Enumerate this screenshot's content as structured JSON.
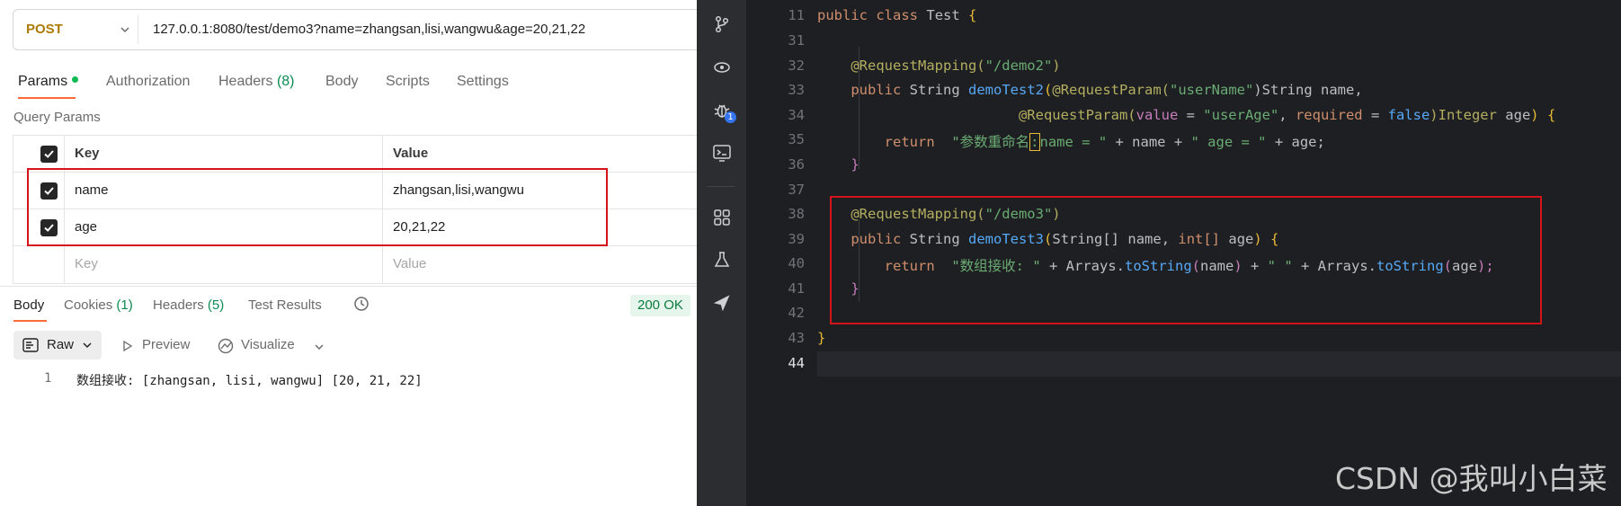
{
  "request": {
    "method": "POST",
    "url": "127.0.0.1:8080/test/demo3?name=zhangsan,lisi,wangwu&age=20,21,22"
  },
  "request_tabs": [
    {
      "label": "Params"
    },
    {
      "label": "Authorization"
    },
    {
      "label": "Headers",
      "count": "(8)"
    },
    {
      "label": "Body"
    },
    {
      "label": "Scripts"
    },
    {
      "label": "Settings"
    }
  ],
  "query_params": {
    "section_label": "Query Params",
    "headers": {
      "key": "Key",
      "value": "Value"
    },
    "rows": [
      {
        "key": "name",
        "value": "zhangsan,lisi,wangwu"
      },
      {
        "key": "age",
        "value": "20,21,22"
      }
    ],
    "placeholder": {
      "key": "Key",
      "value": "Value"
    }
  },
  "response": {
    "tabs": [
      {
        "label": "Body"
      },
      {
        "label": "Cookies",
        "count": "(1)"
      },
      {
        "label": "Headers",
        "count": "(5)"
      },
      {
        "label": "Test Results"
      }
    ],
    "status": "200 OK",
    "view_modes": {
      "raw": "Raw",
      "preview": "Preview",
      "visualize": "Visualize"
    },
    "body_lines": [
      {
        "num": "1",
        "text": "数组接收: [zhangsan, lisi, wangwu] [20, 21, 22]"
      }
    ]
  },
  "ide": {
    "debug_badge": "1",
    "line_numbers": [
      "11",
      "31",
      "32",
      "33",
      "34",
      "35",
      "36",
      "37",
      "38",
      "39",
      "40",
      "41",
      "42",
      "43",
      "44"
    ],
    "current_line": "44",
    "code": {
      "l11": {
        "a": "public",
        "b": "class",
        "c": "Test",
        "d": "{"
      },
      "l32": {
        "a": "@RequestMapping(",
        "b": "\"/demo2\"",
        "c": ")"
      },
      "l33": {
        "a": "public",
        "b": "String",
        "c": "demoTest2",
        "d": "(",
        "e": "@RequestParam(",
        "f": "\"userName\"",
        "g": ")String",
        "h": "name",
        "i": ","
      },
      "l34": {
        "a": "@RequestParam(",
        "b": "value",
        "c": " = ",
        "d": "\"userAge\"",
        "e": ", ",
        "f": "required",
        "g": " = ",
        "h": "false",
        "i": ")Integer",
        "j": "age",
        "k": ")",
        "l": "{"
      },
      "l35": {
        "a": "return",
        "b": "\"参数重命名",
        "c": ":",
        "d": "name = \"",
        "e": " + name + ",
        "f": "\" age = \"",
        "g": " + age;"
      },
      "l36": {
        "a": "}"
      },
      "l38": {
        "a": "@RequestMapping(",
        "b": "\"/demo3\"",
        "c": ")"
      },
      "l39": {
        "a": "public",
        "b": "String",
        "c": "demoTest3",
        "d": "(",
        "e": "String[]",
        "f": "name",
        "g": ", ",
        "h": "int[]",
        "i": "age",
        "j": ")",
        "k": "{"
      },
      "l40": {
        "a": "return",
        "b": "\"数组接收: \"",
        "c": " + ",
        "d": "Arrays",
        "e": ".",
        "f": "toString",
        "g": "(",
        "h": "name",
        "i": ")",
        "j": " + ",
        "k": "\" \"",
        "l": " + ",
        "m": "Arrays",
        "n": ".",
        "o": "toString",
        "p": "(",
        "q": "age",
        "r": ");"
      },
      "l41": {
        "a": "}"
      },
      "l43": {
        "a": "}"
      }
    }
  },
  "watermark": "CSDN @我叫小白菜"
}
